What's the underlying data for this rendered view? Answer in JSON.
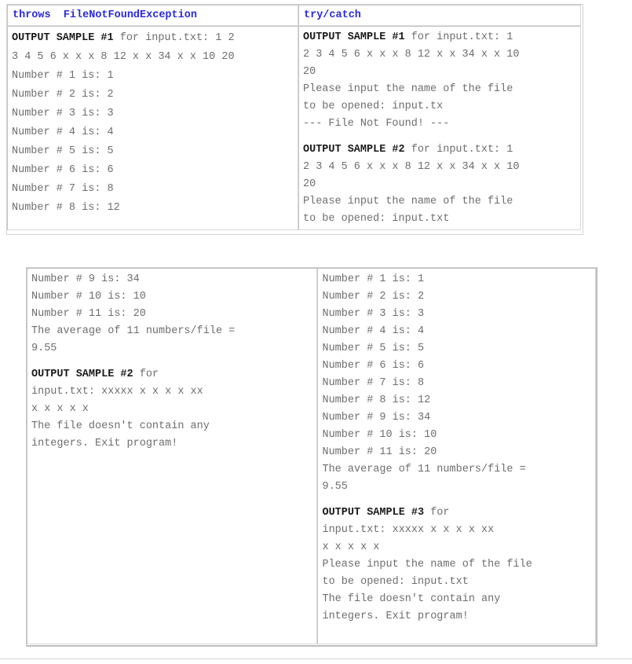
{
  "page": {
    "title": "Java file-IO output samples comparison",
    "header_color": "#2b2bd4",
    "body_text_color": "#6e6e6e",
    "emphasis_color": "#1a1a1a"
  },
  "top_table": {
    "headers": {
      "left": "throws  FileNotFoundException",
      "right": "try/catch"
    },
    "left_panel": {
      "sample_label": "OUTPUT SAMPLE #1",
      "lines": [
        {
          "bold": "OUTPUT SAMPLE #1",
          "rest": " for input.txt: 1 2"
        },
        {
          "bold": "",
          "rest": "3 4 5 6 x x x 8 12 x x 34 x x 10 20"
        },
        {
          "bold": "",
          "rest": "Number # 1 is: 1"
        },
        {
          "bold": "",
          "rest": "Number # 2 is: 2"
        },
        {
          "bold": "",
          "rest": "Number # 3 is: 3"
        },
        {
          "bold": "",
          "rest": "Number # 4 is: 4"
        },
        {
          "bold": "",
          "rest": "Number # 5 is: 5"
        },
        {
          "bold": "",
          "rest": "Number # 6 is: 6"
        },
        {
          "bold": "",
          "rest": "Number # 7 is: 8"
        },
        {
          "bold": "",
          "rest": "Number # 8 is: 12"
        }
      ]
    },
    "right_panel": {
      "lines": [
        {
          "bold": "OUTPUT SAMPLE #1",
          "rest": " for input.txt: 1"
        },
        {
          "bold": "",
          "rest": "2 3 4 5 6 x x x 8 12 x x 34 x x 10"
        },
        {
          "bold": "",
          "rest": "20"
        },
        {
          "bold": "",
          "rest": "Please input the name of the file"
        },
        {
          "bold": "",
          "rest": "to be opened: input.tx"
        },
        {
          "bold": "",
          "rest": "--- File Not Found! ---"
        },
        {
          "bold": "",
          "rest": ""
        },
        {
          "bold": "OUTPUT SAMPLE #2",
          "rest": " for input.txt: 1"
        },
        {
          "bold": "",
          "rest": "2 3 4 5 6 x x x 8 12 x x 34 x x 10"
        },
        {
          "bold": "",
          "rest": "20"
        },
        {
          "bold": "",
          "rest": "Please input the name of the file"
        },
        {
          "bold": "",
          "rest": "to be opened: input.txt"
        }
      ]
    }
  },
  "bottom_table": {
    "left_panel": {
      "lines": [
        {
          "bold": "",
          "rest": "Number # 9 is: 34"
        },
        {
          "bold": "",
          "rest": "Number # 10 is: 10"
        },
        {
          "bold": "",
          "rest": "Number # 11 is: 20"
        },
        {
          "bold": "",
          "rest": "The average of 11 numbers/file ="
        },
        {
          "bold": "",
          "rest": "9.55"
        },
        {
          "bold": "",
          "rest": ""
        },
        {
          "bold": "OUTPUT SAMPLE #2",
          "rest": " for"
        },
        {
          "bold": "",
          "rest": "input.txt: xxxxx x x x x xx"
        },
        {
          "bold": "",
          "rest": "x x x x x"
        },
        {
          "bold": "",
          "rest": "The file doesn't contain any"
        },
        {
          "bold": "",
          "rest": "integers. Exit program!"
        }
      ]
    },
    "right_panel": {
      "lines": [
        {
          "bold": "",
          "rest": "Number # 1 is: 1"
        },
        {
          "bold": "",
          "rest": "Number # 2 is: 2"
        },
        {
          "bold": "",
          "rest": "Number # 3 is: 3"
        },
        {
          "bold": "",
          "rest": "Number # 4 is: 4"
        },
        {
          "bold": "",
          "rest": "Number # 5 is: 5"
        },
        {
          "bold": "",
          "rest": "Number # 6 is: 6"
        },
        {
          "bold": "",
          "rest": "Number # 7 is: 8"
        },
        {
          "bold": "",
          "rest": "Number # 8 is: 12"
        },
        {
          "bold": "",
          "rest": "Number # 9 is: 34"
        },
        {
          "bold": "",
          "rest": "Number # 10 is: 10"
        },
        {
          "bold": "",
          "rest": "Number # 11 is: 20"
        },
        {
          "bold": "",
          "rest": "The average of 11 numbers/file ="
        },
        {
          "bold": "",
          "rest": "9.55"
        },
        {
          "bold": "",
          "rest": ""
        },
        {
          "bold": "OUTPUT SAMPLE #3",
          "rest": " for"
        },
        {
          "bold": "",
          "rest": "input.txt: xxxxx x x x x xx"
        },
        {
          "bold": "",
          "rest": "x x x x x"
        },
        {
          "bold": "",
          "rest": "Please input the name of the file"
        },
        {
          "bold": "",
          "rest": "to be opened: input.txt"
        },
        {
          "bold": "",
          "rest": "The file doesn't contain any"
        },
        {
          "bold": "",
          "rest": "integers. Exit program!"
        }
      ]
    }
  }
}
